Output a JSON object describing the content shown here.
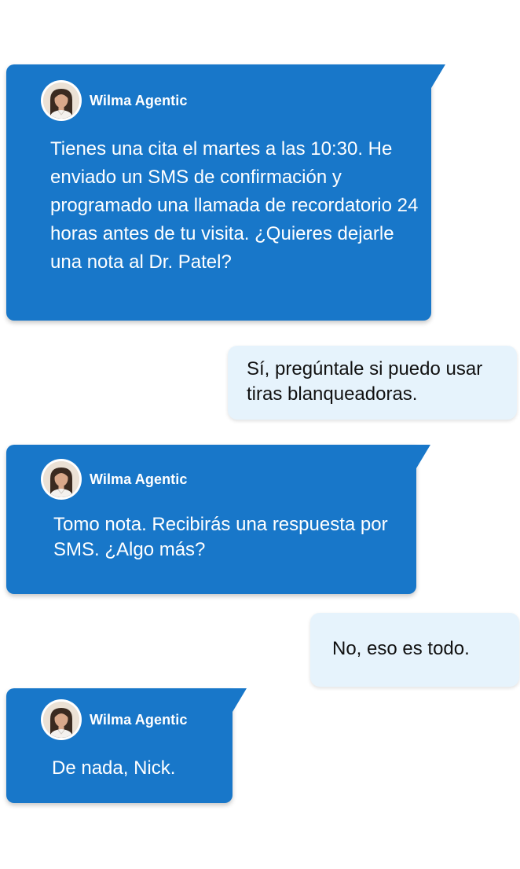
{
  "agent": {
    "name": "Wilma Agentic",
    "avatar_icon": "woman-portrait-avatar-icon",
    "bubble_color": "#1877c9"
  },
  "user": {
    "bubble_color": "#e6f3fc"
  },
  "messages": [
    {
      "from": "agent",
      "text": "Tienes una cita el martes a las 10:30. He enviado un SMS de confirmación y programado una llamada de recordatorio 24 horas antes de tu visita. ¿Quieres dejarle una nota al Dr. Patel?"
    },
    {
      "from": "user",
      "text": "Sí, pregúntale si puedo usar tiras blanqueadoras."
    },
    {
      "from": "agent",
      "text": "Tomo nota. Recibirás una respuesta por SMS. ¿Algo más?"
    },
    {
      "from": "user",
      "text": "No, eso es todo."
    },
    {
      "from": "agent",
      "text": "De nada, Nick."
    }
  ]
}
